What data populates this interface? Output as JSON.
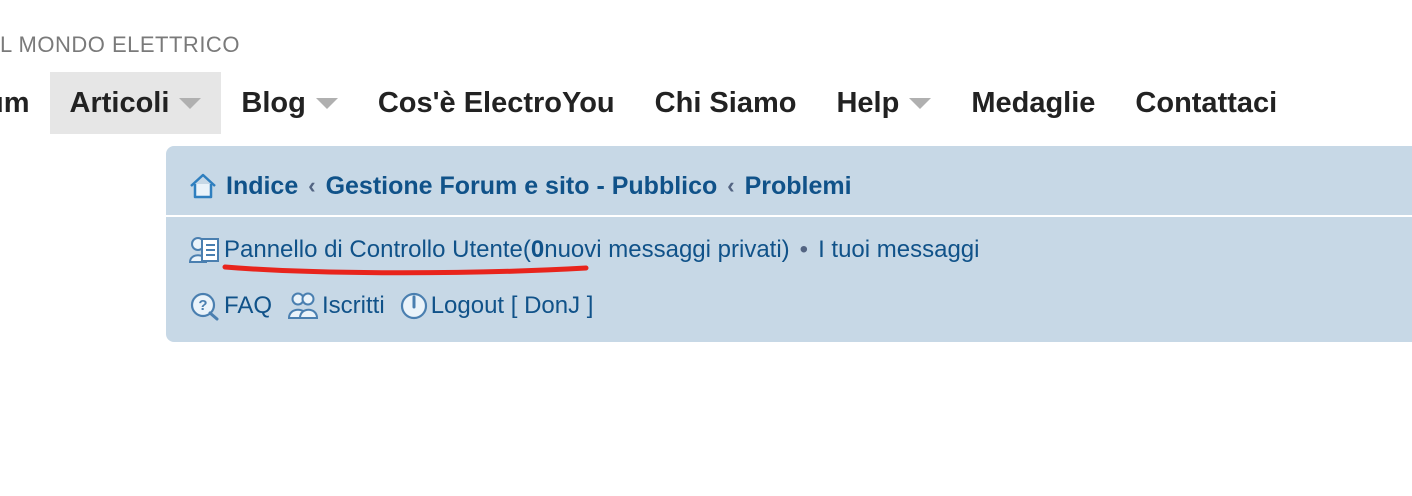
{
  "logo": {
    "tagline": "L MONDO ELETTRICO"
  },
  "nav": {
    "items": [
      {
        "label": "um",
        "has_caret": false
      },
      {
        "label": "Articoli",
        "has_caret": true
      },
      {
        "label": "Blog",
        "has_caret": true
      },
      {
        "label": "Cos'è ElectroYou",
        "has_caret": false
      },
      {
        "label": "Chi Siamo",
        "has_caret": false
      },
      {
        "label": "Help",
        "has_caret": true
      },
      {
        "label": "Medaglie",
        "has_caret": false
      },
      {
        "label": "Contattaci",
        "has_caret": false
      }
    ],
    "active": "Articoli"
  },
  "breadcrumb": {
    "items": [
      "Indice",
      "Gestione Forum e sito - Pubblico",
      "Problemi"
    ],
    "separator": "‹"
  },
  "user_links": {
    "ucp_label": "Pannello di Controllo Utente",
    "pm_open": " (",
    "pm_count": "0",
    "pm_text": " nuovi messaggi privati)",
    "bullet": "•",
    "your_posts": "I tuoi messaggi"
  },
  "quick_links": {
    "faq": "FAQ",
    "members": "Iscritti",
    "logout": "Logout [ DonJ ]"
  },
  "colors": {
    "panel_bg": "#c7d8e6",
    "link": "#105289",
    "annotation": "#e8241c",
    "logo_orange": "#f5a623",
    "nav_active_bg": "#e6e6e6"
  }
}
